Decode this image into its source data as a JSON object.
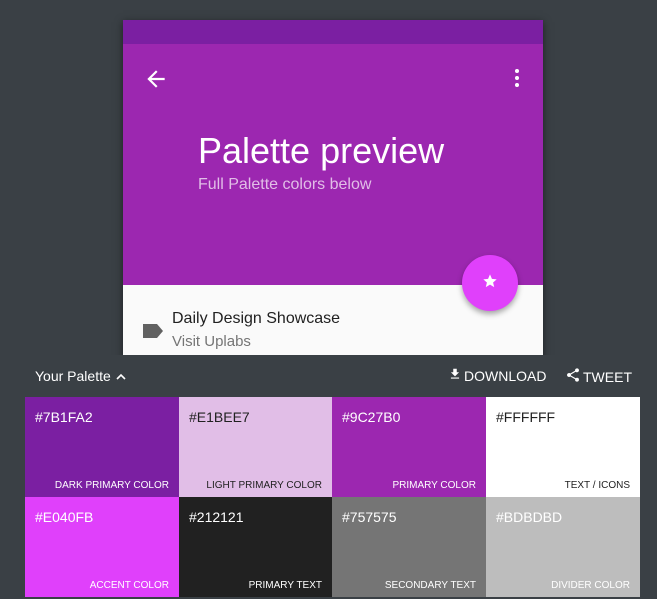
{
  "app": {
    "title": "Palette preview",
    "subtitle": "Full Palette colors below",
    "icons": {
      "back": "arrow-back-icon",
      "menu": "more-vert-icon",
      "fab": "star-icon",
      "label": "label-icon"
    },
    "list_item": {
      "primary": "Daily Design Showcase",
      "secondary": "Visit Uplabs"
    }
  },
  "panel": {
    "title": "Your Palette",
    "download_label": "DOWNLOAD",
    "tweet_label": "TWEET",
    "swatches": [
      {
        "hex": "#7B1FA2",
        "label": "DARK PRIMARY COLOR",
        "text_color": "#ffffff"
      },
      {
        "hex": "#E1BEE7",
        "label": "LIGHT PRIMARY COLOR",
        "text_color": "#212121"
      },
      {
        "hex": "#9C27B0",
        "label": "PRIMARY COLOR",
        "text_color": "#ffffff"
      },
      {
        "hex": "#FFFFFF",
        "label": "TEXT / ICONS",
        "text_color": "#212121"
      },
      {
        "hex": "#E040FB",
        "label": "ACCENT COLOR",
        "text_color": "#ffffff"
      },
      {
        "hex": "#212121",
        "label": "PRIMARY TEXT",
        "text_color": "#ffffff"
      },
      {
        "hex": "#757575",
        "label": "SECONDARY TEXT",
        "text_color": "#ffffff"
      },
      {
        "hex": "#BDBDBD",
        "label": "DIVIDER COLOR",
        "text_color": "#ffffff"
      }
    ]
  },
  "colors": {
    "background": "#3a4045",
    "status_bar": "#7b1fa2",
    "app_bar": "#9c27b0",
    "accent": "#e040fb"
  }
}
